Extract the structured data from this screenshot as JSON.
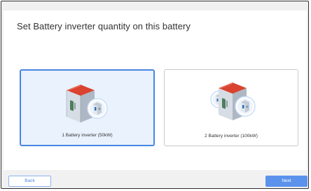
{
  "dialog": {
    "title": "Set Battery inverter quantity on this battery"
  },
  "options": [
    {
      "label": "1 Battery inverter (50kW)",
      "selected": true,
      "icon": "battery-cabinet-single-inverter-icon"
    },
    {
      "label": "2 Battery inverter (100kW)",
      "selected": false,
      "icon": "battery-cabinet-dual-inverter-icon"
    }
  ],
  "footer": {
    "back_label": "Back",
    "next_label": "Next"
  },
  "colors": {
    "accent": "#4a86e2",
    "next_button": "#5b93ec",
    "selected_card_bg": "#e9f2fd",
    "cabinet_roof": "#d9432f"
  }
}
